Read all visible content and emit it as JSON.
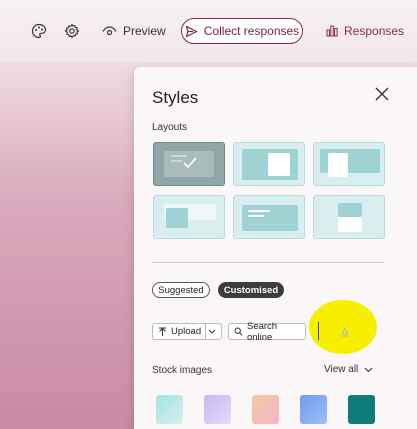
{
  "toolbar": {
    "icons": [
      "palette-icon",
      "gear-icon"
    ],
    "preview_label": "Preview",
    "collect_label": "Collect responses",
    "responses_label": "Responses",
    "accent": "#8a2a4e"
  },
  "panel": {
    "title": "Styles",
    "layouts_label": "Layouts",
    "layouts_selected_index": 0,
    "tabs": [
      {
        "label": "Suggested",
        "active": false
      },
      {
        "label": "Customised",
        "active": true
      }
    ],
    "upload_label": "Upload",
    "search_online_label": "Search online",
    "stock_images_label": "Stock images",
    "view_all_label": "View all",
    "swatches": [
      {
        "name": "aqua-gradient",
        "from": "#a6e3e0",
        "to": "#d6f0ef"
      },
      {
        "name": "lavender-gradient",
        "from": "#c7b8f3",
        "to": "#e3dafb"
      },
      {
        "name": "peach-gradient",
        "from": "#f6c7a0",
        "to": "#f3b8c7"
      },
      {
        "name": "blue-gradient",
        "from": "#6d9cf0",
        "to": "#9ebef6"
      },
      {
        "name": "teal-solid",
        "from": "#0f7b7b",
        "to": "#0f7b7b"
      }
    ],
    "highlight_color": "#f6f000"
  }
}
